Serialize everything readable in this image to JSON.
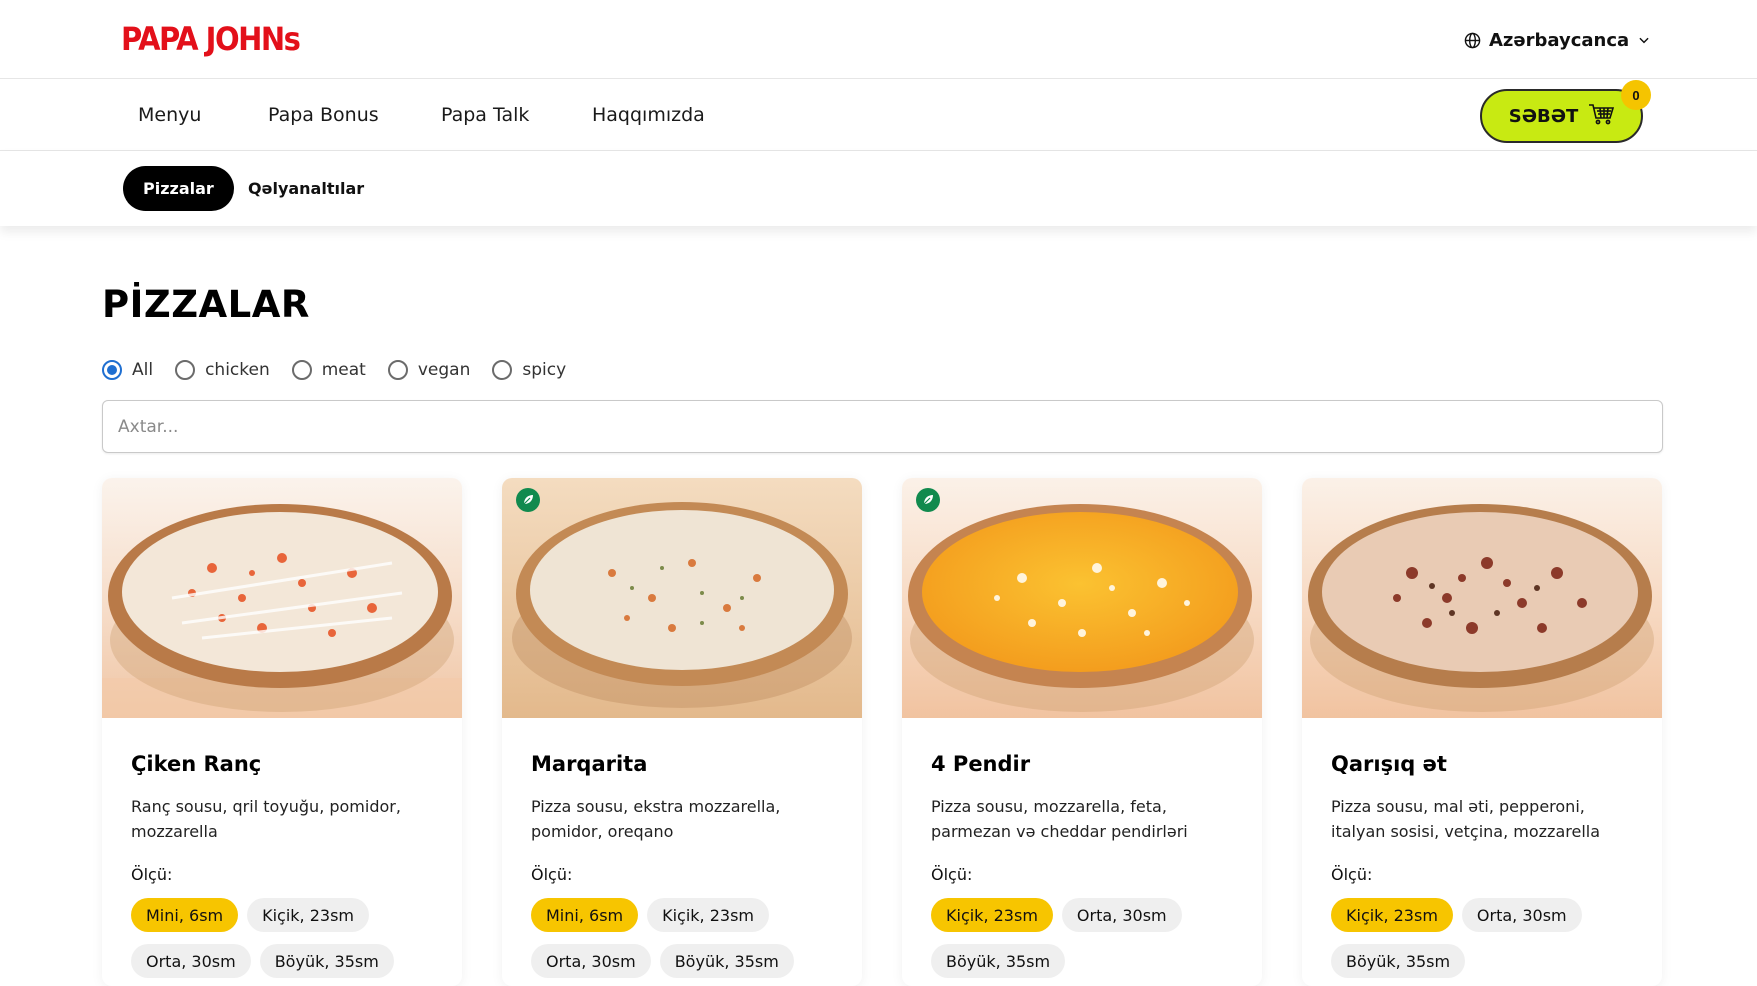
{
  "brand": {
    "logo_text": "PAPA JOHNs",
    "accent": "#e3101a",
    "cart_color": "#c8ea12",
    "highlight": "#f7c500"
  },
  "header": {
    "language": "Azərbaycanca"
  },
  "nav": {
    "items": [
      {
        "label": "Menyu"
      },
      {
        "label": "Papa Bonus"
      },
      {
        "label": "Papa Talk"
      },
      {
        "label": "Haqqımızda"
      }
    ],
    "cart_label": "SƏBƏT",
    "cart_count": "0"
  },
  "categories": [
    {
      "label": "Pizzalar",
      "active": true
    },
    {
      "label": "Qəlyanaltılar",
      "active": false
    }
  ],
  "page": {
    "title": "PİZZALAR"
  },
  "filters": [
    {
      "label": "All",
      "checked": true
    },
    {
      "label": "chicken",
      "checked": false
    },
    {
      "label": "meat",
      "checked": false
    },
    {
      "label": "vegan",
      "checked": false
    },
    {
      "label": "spicy",
      "checked": false
    }
  ],
  "search": {
    "placeholder": "Axtar..."
  },
  "size_label": "Ölçü:",
  "products": [
    {
      "title": "Çiken Ranç",
      "desc": "Ranç sousu, qril toyuğu, pomidor, mozzarella",
      "vegetarian": false,
      "sizes": [
        "Mini, 6sm",
        "Kiçik, 23sm",
        "Orta, 30sm",
        "Böyük, 35sm"
      ],
      "selected_size": 0,
      "image": "pizza-chicken-ranch"
    },
    {
      "title": "Marqarita",
      "desc": "Pizza sousu, ekstra mozzarella, pomidor, oreqano",
      "vegetarian": true,
      "sizes": [
        "Mini, 6sm",
        "Kiçik, 23sm",
        "Orta, 30sm",
        "Böyük, 35sm"
      ],
      "selected_size": 0,
      "image": "pizza-margherita"
    },
    {
      "title": "4 Pendir",
      "desc": "Pizza sousu, mozzarella, feta, parmezan və cheddar pendirləri",
      "vegetarian": true,
      "sizes": [
        "Kiçik, 23sm",
        "Orta, 30sm",
        "Böyük, 35sm"
      ],
      "selected_size": 0,
      "image": "pizza-four-cheese"
    },
    {
      "title": "Qarışıq ət",
      "desc": "Pizza sousu, mal əti, pepperoni, italyan sosisi, vetçina, mozzarella",
      "vegetarian": false,
      "sizes": [
        "Kiçik, 23sm",
        "Orta, 30sm",
        "Böyük, 35sm"
      ],
      "selected_size": 0,
      "image": "pizza-mixed-meat"
    }
  ]
}
